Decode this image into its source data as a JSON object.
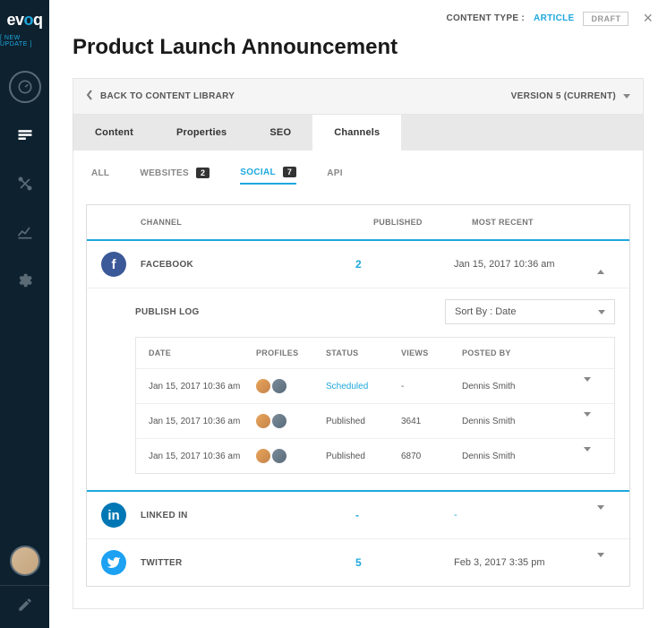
{
  "logo": {
    "pre": "ev",
    "accent": "o",
    "post": "q"
  },
  "newUpdate": "[ NEW UPDATE ]",
  "topBar": {
    "contentTypeLabel": "CONTENT TYPE  :",
    "contentTypeValue": "ARTICLE",
    "draft": "DRAFT"
  },
  "pageTitle": "Product Launch Announcement",
  "backRow": {
    "back": "BACK TO CONTENT LIBRARY",
    "version": "VERSION 5 (CURRENT)"
  },
  "tabs": [
    "Content",
    "Properties",
    "SEO",
    "Channels"
  ],
  "subtabs": {
    "all": "ALL",
    "websites": "WEBSITES",
    "websitesCount": "2",
    "social": "SOCIAL",
    "socialCount": "7",
    "api": "API"
  },
  "channelsHeader": {
    "channel": "CHANNEL",
    "published": "PUBLISHED",
    "recent": "MOST RECENT"
  },
  "channels": [
    {
      "icon": "facebook",
      "name": "FACEBOOK",
      "published": "2",
      "recent": "Jan 15, 2017  10:36 am",
      "expanded": true
    },
    {
      "icon": "linkedin",
      "name": "LINKED IN",
      "published": "-",
      "recent": "-",
      "expanded": false
    },
    {
      "icon": "twitter",
      "name": "TWITTER",
      "published": "5",
      "recent": "Feb 3, 2017  3:35 pm",
      "expanded": false
    }
  ],
  "publishLog": {
    "title": "PUBLISH LOG",
    "sortLabel": "Sort By : Date",
    "head": {
      "date": "DATE",
      "profiles": "PROFILES",
      "status": "STATUS",
      "views": "VIEWS",
      "posted": "POSTED BY"
    },
    "rows": [
      {
        "date": "Jan 15, 2017  10:36 am",
        "status": "Scheduled",
        "views": "-",
        "posted": "Dennis Smith",
        "sched": true
      },
      {
        "date": "Jan 15, 2017  10:36 am",
        "status": "Published",
        "views": "3641",
        "posted": "Dennis Smith",
        "sched": false
      },
      {
        "date": "Jan 15, 2017  10:36 am",
        "status": "Published",
        "views": "6870",
        "posted": "Dennis Smith",
        "sched": false
      }
    ]
  }
}
